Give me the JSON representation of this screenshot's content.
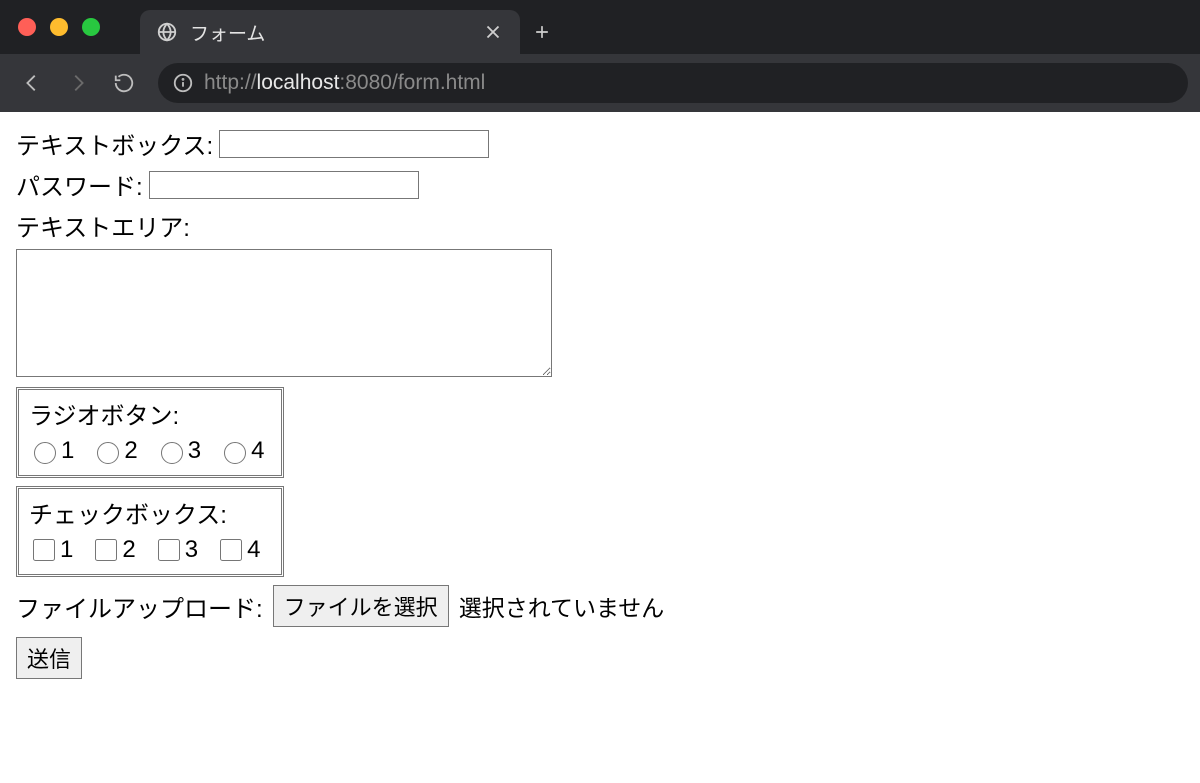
{
  "browser": {
    "tab_title": "フォーム",
    "url_scheme": "http://",
    "url_host": "localhost",
    "url_port": ":8080",
    "url_path": "/form.html"
  },
  "form": {
    "text_label": "テキストボックス:",
    "text_value": "",
    "password_label": "パスワード:",
    "password_value": "",
    "textarea_label": "テキストエリア:",
    "textarea_value": "",
    "radio_group_label": "ラジオボタン:",
    "radio_options": [
      "1",
      "2",
      "3",
      "4"
    ],
    "checkbox_group_label": "チェックボックス:",
    "checkbox_options": [
      "1",
      "2",
      "3",
      "4"
    ],
    "file_label": "ファイルアップロード:",
    "file_button": "ファイルを選択",
    "file_status": "選択されていません",
    "submit_label": "送信"
  }
}
